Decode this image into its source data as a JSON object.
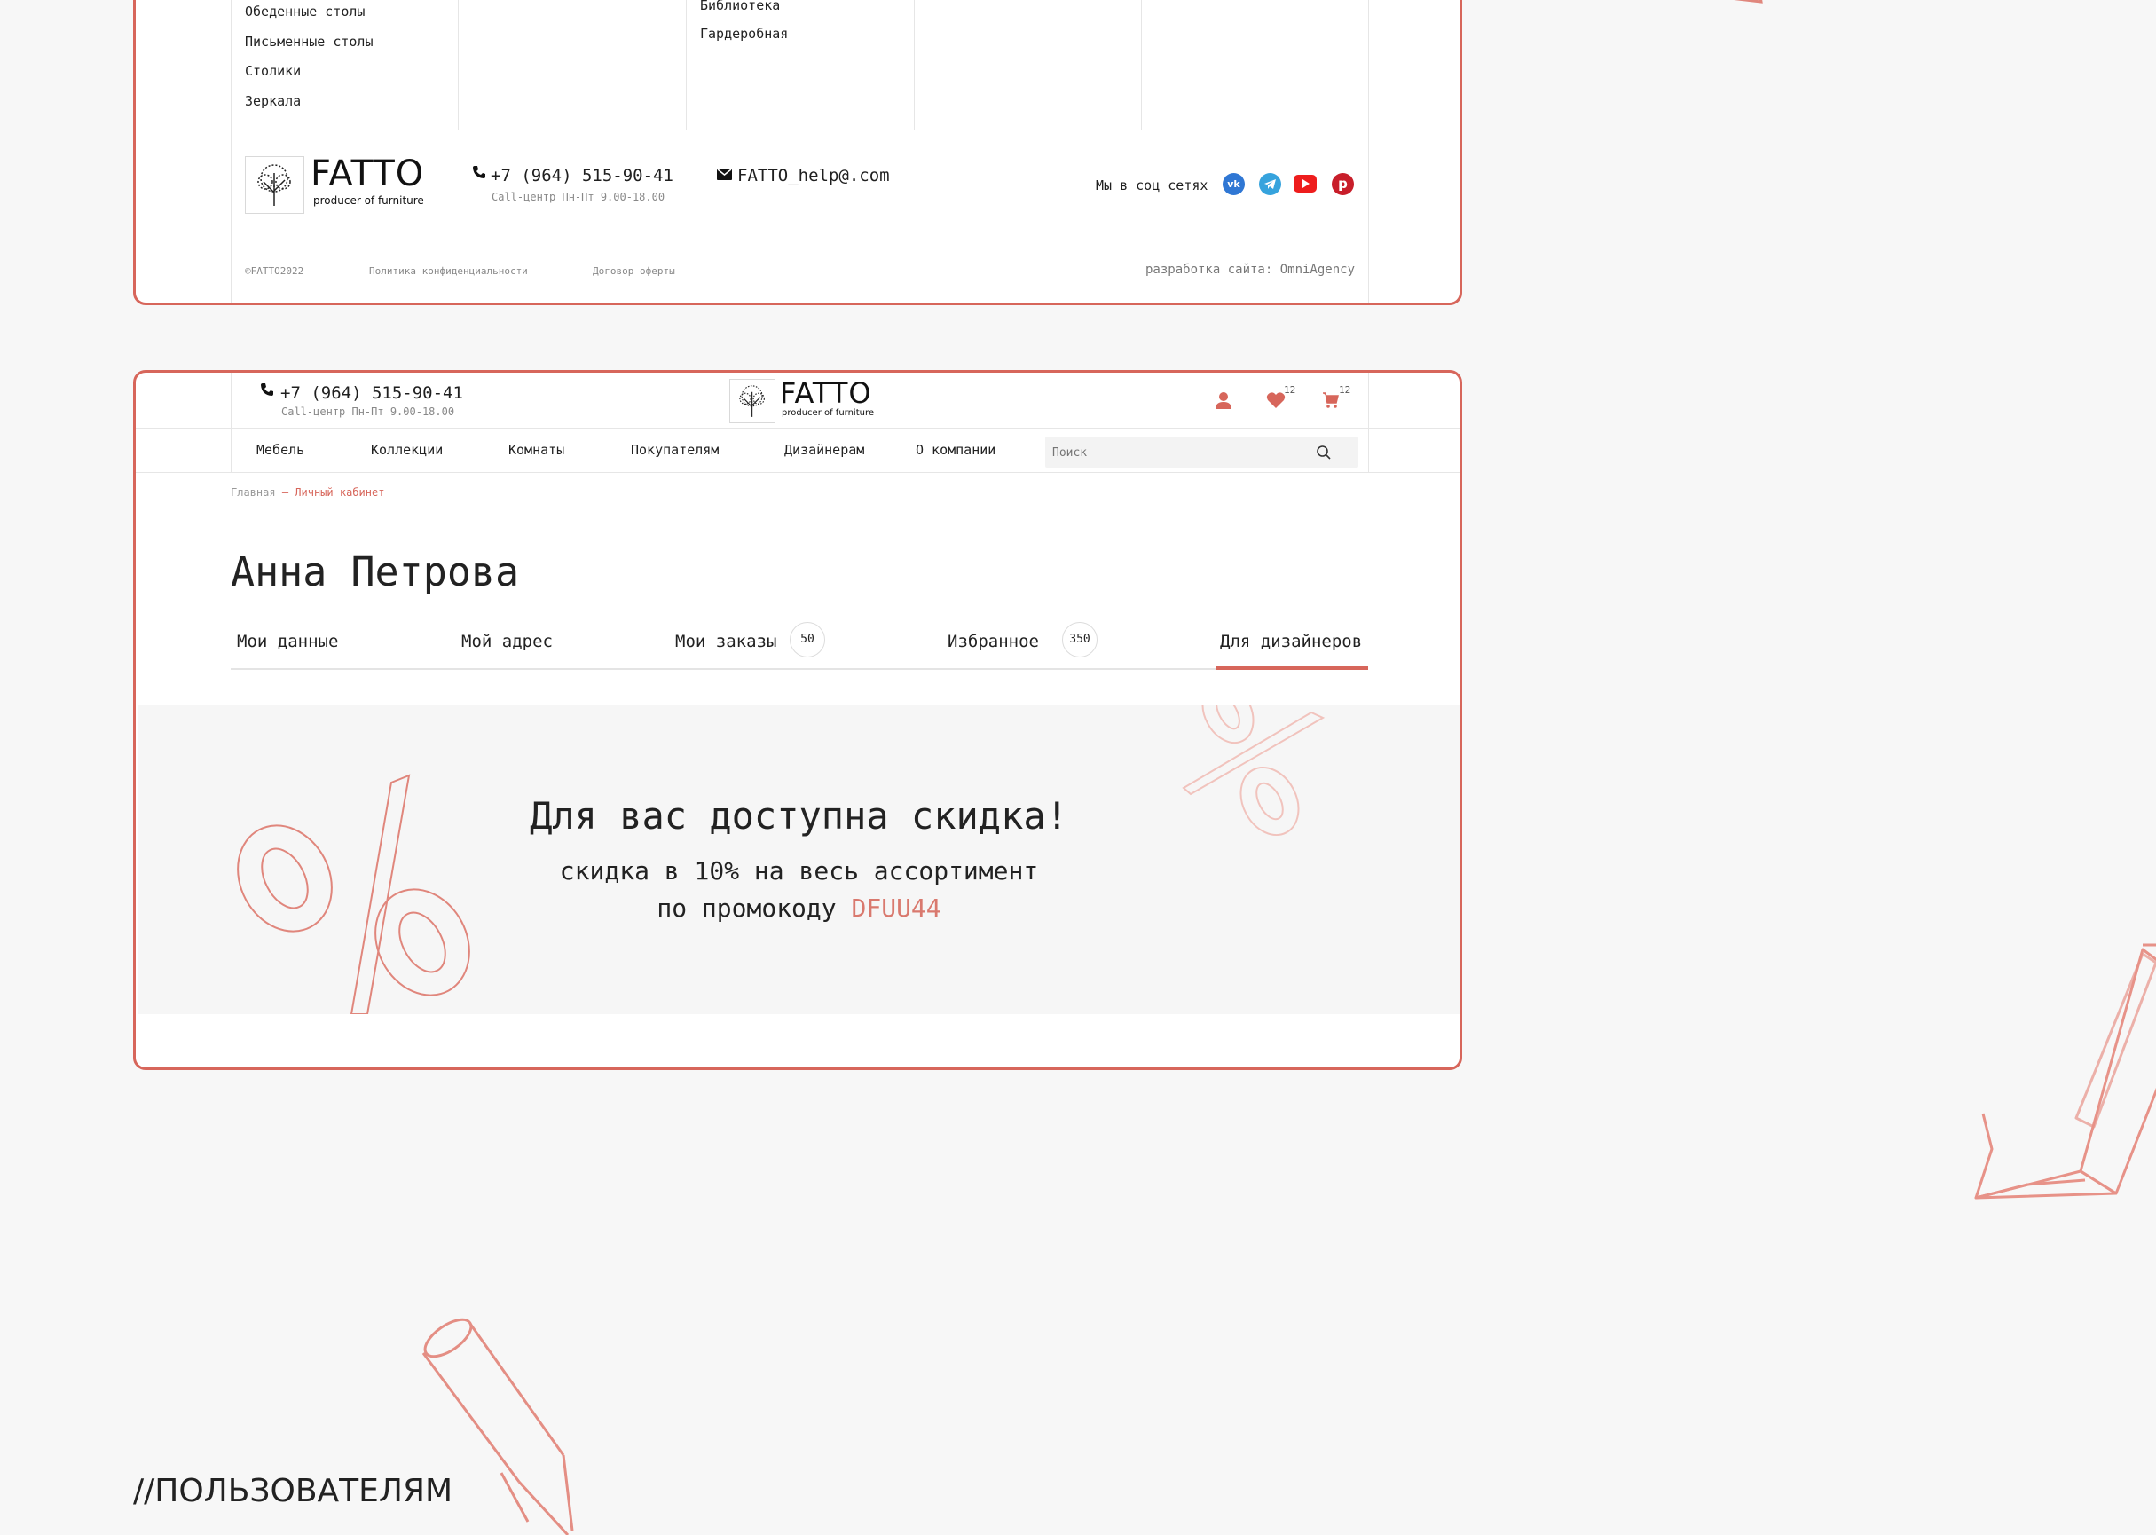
{
  "footer": {
    "menu_col1": [
      "Обеденные столы",
      "Письменные столы",
      "Столики",
      "Зеркала"
    ],
    "menu_col2": [
      "Библиотека",
      "Гардеробная"
    ],
    "phone": "+7 (964) 515-90-41",
    "phone_hours": "Call-центр Пн-Пт 9.00-18.00",
    "email": "FATTO_help@.com",
    "social_label": "Мы в соц сетях",
    "social_icons": [
      "vk-icon",
      "telegram-icon",
      "youtube-icon",
      "pinterest-icon"
    ],
    "copyright": "©FATTO2022",
    "privacy": "Политика конфиденциальности",
    "offer": "Договор оферты",
    "dev_credit": "разработка сайта: OmniAgency"
  },
  "brand": {
    "name": "FATTO",
    "tagline": "producer of furniture",
    "accent_color": "#d7665b"
  },
  "header": {
    "phone": "+7 (964) 515-90-41",
    "phone_hours": "Call-центр Пн-Пт 9.00-18.00",
    "favorites_count": "12",
    "cart_count": "12",
    "nav": [
      "Мебель",
      "Коллекции",
      "Комнаты",
      "Покупателям",
      "Дизайнерам",
      "О компании"
    ],
    "search_placeholder": "Поиск"
  },
  "breadcrumb": {
    "home": "Главная",
    "separator": "—",
    "current": "Личный кабинет"
  },
  "profile": {
    "name": "Анна Петрова",
    "tabs": {
      "data": "Мои данные",
      "address": "Мой адрес",
      "orders": "Мои заказы",
      "orders_count": "50",
      "favorites": "Избранное",
      "favorites_count": "350",
      "designers": "Для дизайнеров"
    },
    "active_tab": "Для дизайнеров"
  },
  "promo": {
    "title": "Для вас доступна скидка!",
    "line1": "скидка в 10% на весь ассортимент",
    "line2_prefix": "по промокоду",
    "code": "DFUU44"
  },
  "section_heading": "//ПОЛЬЗОВАТЕЛЯМ"
}
